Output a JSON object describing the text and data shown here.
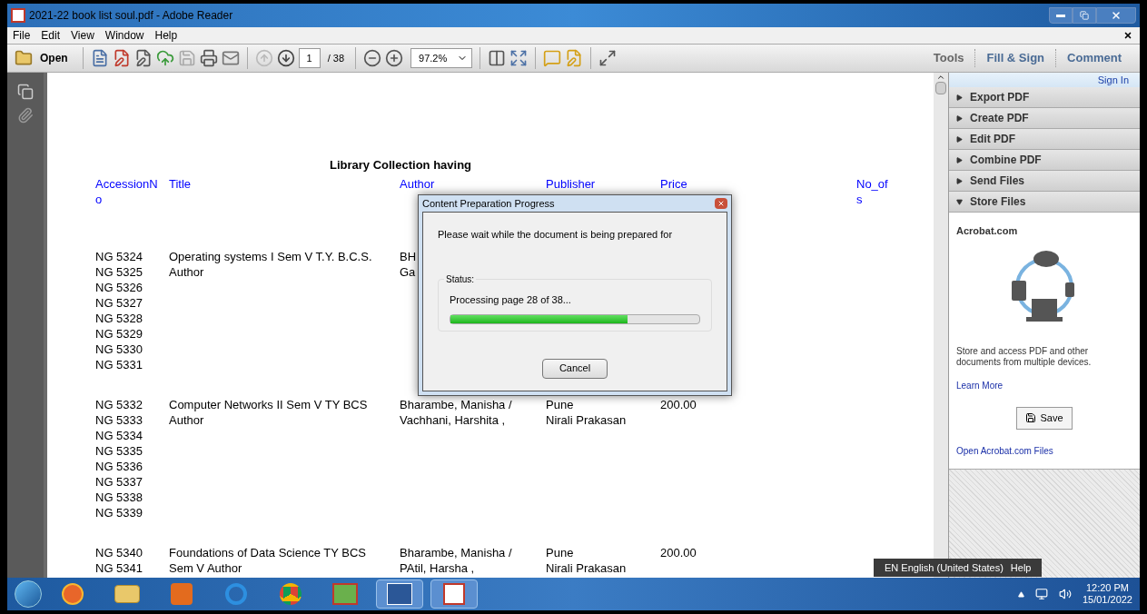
{
  "window": {
    "title": "2021-22 book list soul.pdf - Adobe Reader"
  },
  "menu": [
    "File",
    "Edit",
    "View",
    "Window",
    "Help"
  ],
  "toolbar": {
    "open_label": "Open",
    "page": "1",
    "page_total": "/ 38",
    "zoom": "97.2%",
    "tabs": [
      "Tools",
      "Fill & Sign",
      "Comment"
    ]
  },
  "document": {
    "heading": "Library Collection having",
    "columns": [
      [
        "AccessionN",
        "o"
      ],
      [
        "Title"
      ],
      [
        "Author"
      ],
      [
        "Publisher"
      ],
      [
        "Price"
      ],
      [
        "No_of",
        "s"
      ]
    ],
    "groups": [
      {
        "accession": [
          "NG 5324",
          "NG 5325",
          "NG 5326",
          "NG 5327",
          "NG 5328",
          "NG 5329",
          "NG 5330",
          "NG 5331"
        ],
        "title": [
          "Operating systems I Sem V T.Y. B.C.S.",
          "Author"
        ],
        "author": [
          "BH",
          "Ga"
        ]
      },
      {
        "accession": [
          "NG 5332",
          "NG 5333",
          "NG 5334",
          "NG 5335",
          "NG 5336",
          "NG 5337",
          "NG 5338",
          "NG 5339"
        ],
        "title": [
          "Computer Networks II Sem V TY BCS",
          "Author"
        ],
        "author": [
          "Bharambe, Manisha /",
          "Vachhani, Harshita ,"
        ],
        "publisher": [
          "Pune",
          "Nirali Prakasan"
        ],
        "price": "200.00"
      },
      {
        "accession": [
          "NG 5340",
          "NG 5341"
        ],
        "title": [
          "Foundations of Data Science TY BCS",
          "Sem V Author"
        ],
        "author": [
          "Bharambe, Manisha /",
          "PAtil, Harsha ,"
        ],
        "publisher": [
          "Pune",
          "Nirali Prakasan"
        ],
        "price": "200.00"
      }
    ]
  },
  "dialog": {
    "title": "Content Preparation Progress",
    "message": "Please wait while the document is being prepared for",
    "status_label": "Status:",
    "status": "Processing page 28 of 38...",
    "level": 0.71,
    "button": "Cancel"
  },
  "right_pane": {
    "sign_in": "Sign In",
    "sections": [
      {
        "label": "Export PDF",
        "expanded": false
      },
      {
        "label": "Create PDF",
        "expanded": false
      },
      {
        "label": "Edit PDF",
        "expanded": false
      },
      {
        "label": "Combine PDF",
        "expanded": false
      },
      {
        "label": "Send Files",
        "expanded": false
      },
      {
        "label": "Store Files",
        "expanded": true
      }
    ],
    "store": {
      "heading": "Acrobat.com",
      "description": "Store and access PDF and other documents from multiple devices.",
      "learn_more": "Learn More",
      "save": "Save",
      "open_files": "Open Acrobat.com Files"
    }
  },
  "language_bar": {
    "language": "EN English (United States)",
    "help": "Help"
  },
  "taskbar": {
    "apps": [
      {
        "kind": "firefox",
        "open": false
      },
      {
        "kind": "folder",
        "open": false
      },
      {
        "kind": "media",
        "open": false
      },
      {
        "kind": "ie",
        "open": false
      },
      {
        "kind": "chrome",
        "open": false
      },
      {
        "kind": "green",
        "open": false
      },
      {
        "kind": "word",
        "open": true
      },
      {
        "kind": "acrobat",
        "open": true
      }
    ],
    "time": "12:20 PM",
    "date": "15/01/2022"
  }
}
